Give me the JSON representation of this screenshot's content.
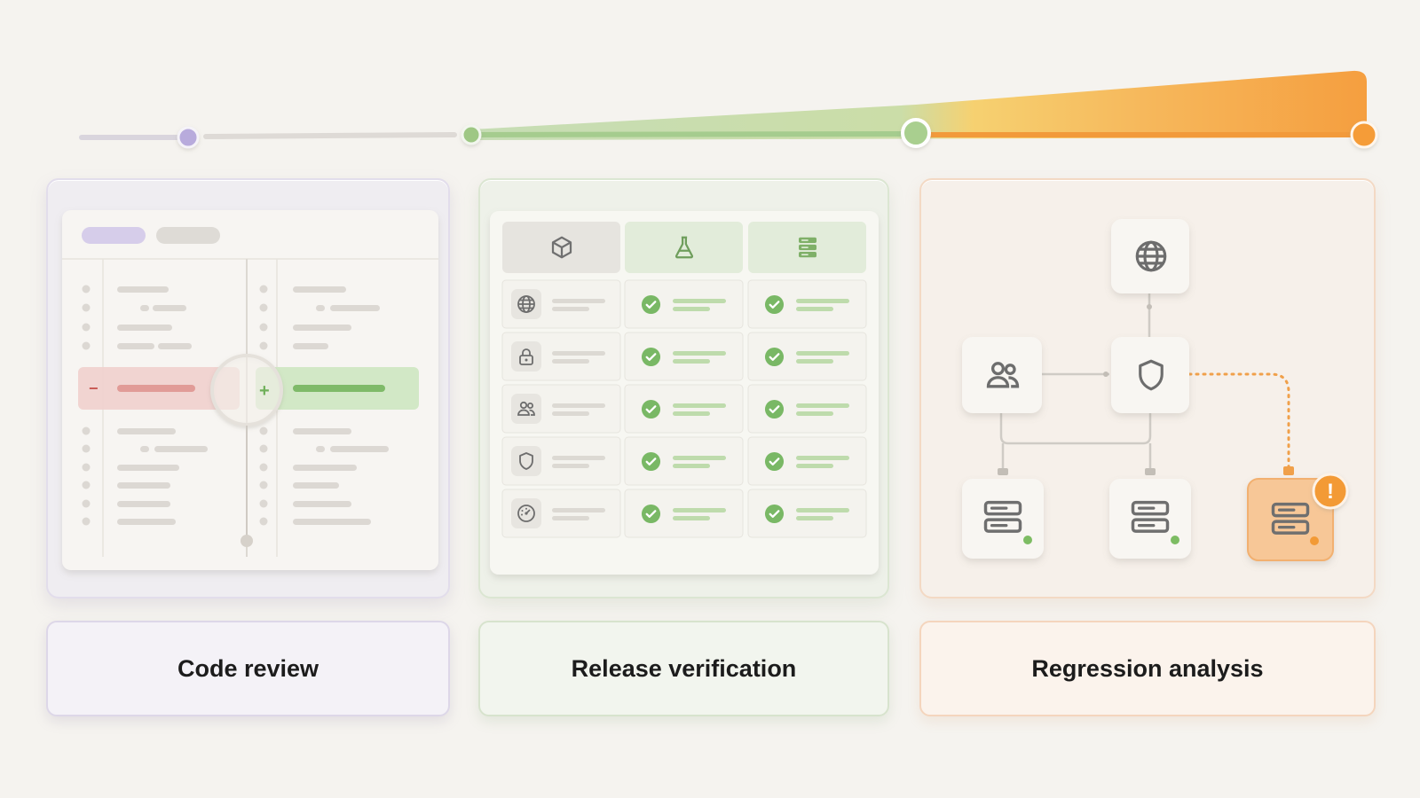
{
  "stages": [
    {
      "id": "code-review",
      "label": "Code review",
      "accent": "#b9abdc"
    },
    {
      "id": "release-verification",
      "label": "Release verification",
      "accent": "#8cc07a"
    },
    {
      "id": "regression-analysis",
      "label": "Regression analysis",
      "accent": "#f5a13e"
    }
  ],
  "diff_view": {
    "removed_marker": "−",
    "added_marker": "+"
  },
  "verification_table": {
    "column_icons": [
      "cube-icon",
      "flask-icon",
      "database-icon"
    ],
    "row_icons": [
      "globe-icon",
      "lock-icon",
      "users-icon",
      "shield-icon",
      "gauge-icon"
    ],
    "status": "check"
  },
  "architecture": {
    "nodes": [
      "globe-icon",
      "users-icon",
      "shield-icon",
      "server-icon",
      "server-icon",
      "server-icon"
    ],
    "alert_marker": "!"
  },
  "colors": {
    "background": "#f5f3ef",
    "purple": "#b9abdc",
    "green": "#8cc07a",
    "orange": "#f5a13e",
    "red": "#e9a0a0"
  }
}
